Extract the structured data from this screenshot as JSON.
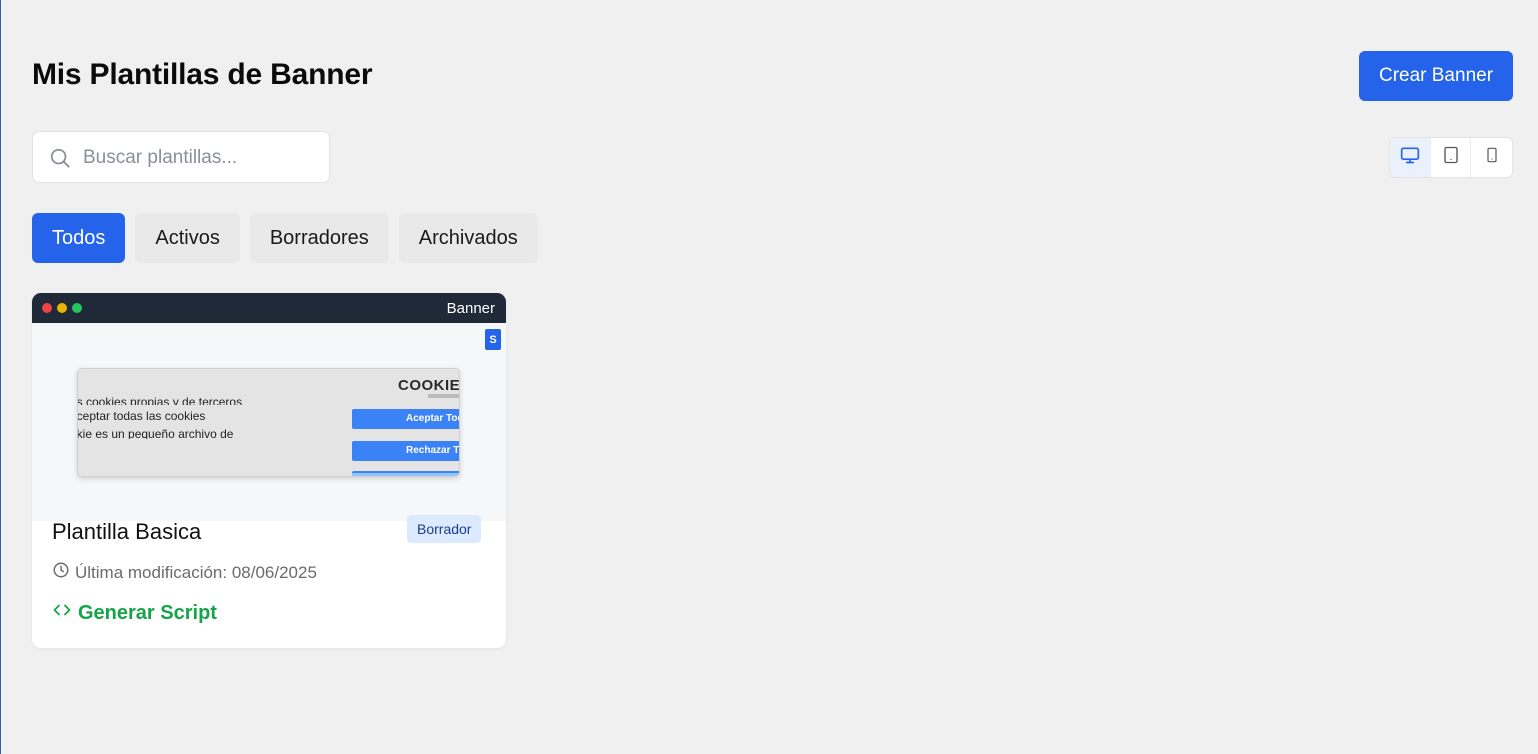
{
  "header": {
    "title": "Mis Plantillas de Banner",
    "create_button": "Crear Banner"
  },
  "search": {
    "placeholder": "Buscar plantillas...",
    "value": "",
    "icon": "search-icon"
  },
  "device_toggle": {
    "items": [
      {
        "icon": "desktop-icon",
        "active": true
      },
      {
        "icon": "tablet-icon",
        "active": false
      },
      {
        "icon": "mobile-icon",
        "active": false
      }
    ]
  },
  "tabs": [
    {
      "label": "Todos",
      "active": true
    },
    {
      "label": "Activos",
      "active": false
    },
    {
      "label": "Borradores",
      "active": false
    },
    {
      "label": "Archivados",
      "active": false
    }
  ],
  "templates": [
    {
      "preview": {
        "bar_label": "Banner",
        "badge": "S",
        "banner_lines": [
          "es cookies propias y de terceros",
          "aceptar todas las cookies",
          "okie es un pequeño archivo de"
        ],
        "logo_text": "COOKIE",
        "accept_label": "Aceptar Todo",
        "reject_label": "Rechazar Todo"
      },
      "name": "Plantilla Basica",
      "status": "Borrador",
      "modified": "Última modificación: 08/06/2025",
      "action": "Generar Script"
    }
  ],
  "colors": {
    "accent": "#2563eb",
    "success": "#16a34a",
    "background": "#f0f0f0",
    "browser_bar": "#1f2937"
  }
}
